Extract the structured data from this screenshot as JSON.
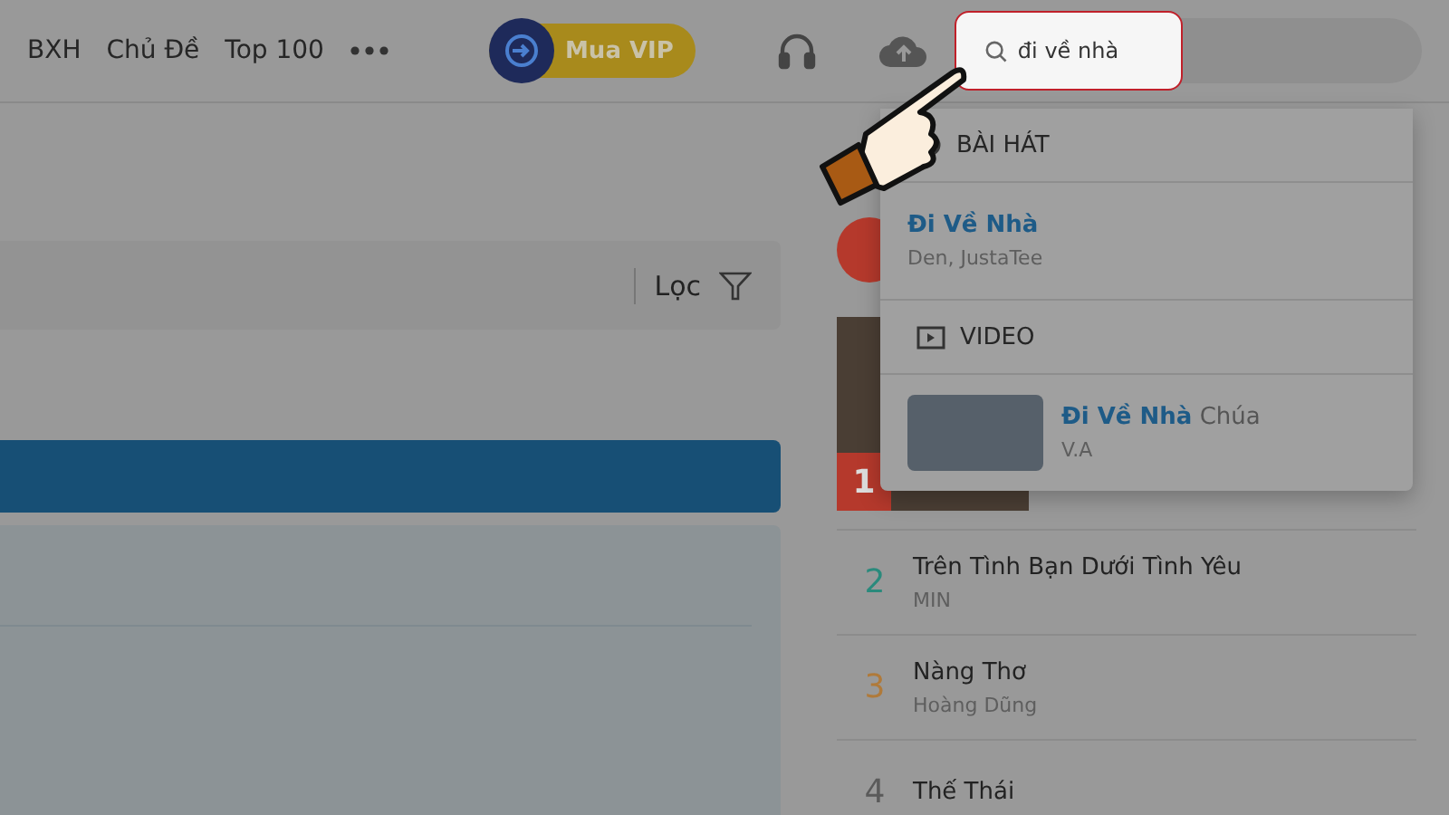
{
  "header": {
    "nav": [
      {
        "label": "BXH"
      },
      {
        "label": "Chủ Đề"
      },
      {
        "label": "Top 100"
      }
    ],
    "vip_button": "Mua VIP",
    "search": {
      "value": "đi về nhà"
    }
  },
  "search_results": [
    {
      "kind": "song",
      "heading": "BÀI HÁT",
      "items": [
        {
          "title": "Đi Về Nhà",
          "artist": "Den, JustaTee"
        }
      ]
    },
    {
      "kind": "video",
      "heading": "VIDEO",
      "items": [
        {
          "title": "Đi Về Nhà",
          "title_rest": "Chúa",
          "artist": "V.A"
        }
      ]
    }
  ],
  "filter": {
    "label": "Lọc"
  },
  "top_list": [
    {
      "rank": "1",
      "color": "#b5392c"
    },
    {
      "rank": "2",
      "title": "Trên Tình Bạn Dưới Tình Yêu",
      "artist": "MIN",
      "color": "#2a8a7c"
    },
    {
      "rank": "3",
      "title": "Nàng Thơ",
      "artist": "Hoàng Dũng",
      "color": "#b07a3a"
    },
    {
      "rank": "4",
      "title": "Thế Thái",
      "color": "#5a5a5a"
    }
  ]
}
